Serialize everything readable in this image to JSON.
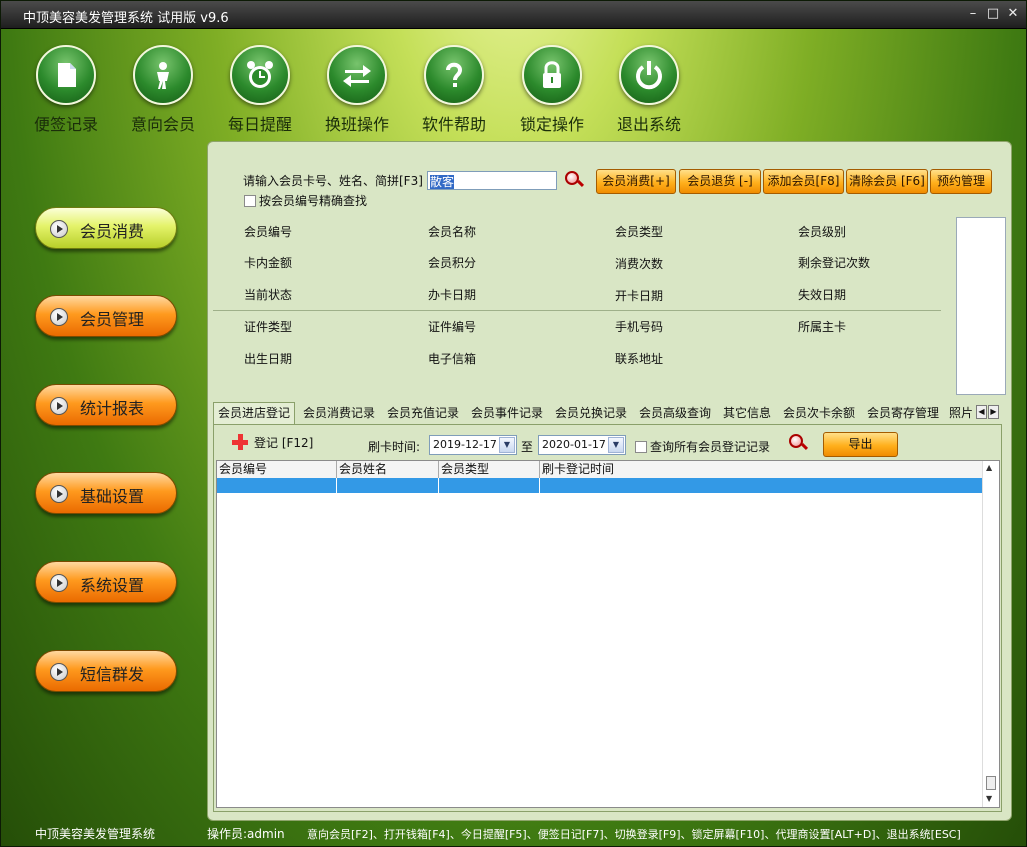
{
  "window": {
    "title": "中顶美容美发管理系统 试用版 v9.6",
    "controls": {
      "minimize": "–",
      "maximize": "□",
      "close": "✕"
    }
  },
  "toolbar": [
    {
      "label": "便签记录",
      "icon": "note-icon"
    },
    {
      "label": "意向会员",
      "icon": "person-icon"
    },
    {
      "label": "每日提醒",
      "icon": "alarm-clock-icon"
    },
    {
      "label": "换班操作",
      "icon": "swap-arrows-icon"
    },
    {
      "label": "软件帮助",
      "icon": "question-icon"
    },
    {
      "label": "锁定操作",
      "icon": "lock-icon"
    },
    {
      "label": "退出系统",
      "icon": "power-icon"
    }
  ],
  "sidebar": [
    {
      "label": "会员消费",
      "active": true
    },
    {
      "label": "会员管理",
      "active": false
    },
    {
      "label": "统计报表",
      "active": false
    },
    {
      "label": "基础设置",
      "active": false
    },
    {
      "label": "系统设置",
      "active": false
    },
    {
      "label": "短信群发",
      "active": false
    }
  ],
  "search": {
    "label": "请输入会员卡号、姓名、简拼[F3]",
    "value": "散客",
    "exact_label": "按会员编号精确查找",
    "exact_checked": false
  },
  "actions": [
    "会员消费[+]",
    "会员退货 [-]",
    "添加会员[F8]",
    "清除会员 [F6]",
    "预约管理"
  ],
  "info_fields": [
    [
      "会员编号",
      "会员名称",
      "会员类型",
      "会员级别"
    ],
    [
      "卡内金额",
      "会员积分",
      "消费次数",
      "剩余登记次数"
    ],
    [
      "当前状态",
      "办卡日期",
      "开卡日期",
      "失效日期"
    ],
    [
      "证件类型",
      "证件编号",
      "手机号码",
      "所属主卡"
    ],
    [
      "出生日期",
      "电子信箱",
      "联系地址"
    ]
  ],
  "tabs": [
    "会员进店登记",
    "会员消费记录",
    "会员充值记录",
    "会员事件记录",
    "会员兑换记录",
    "会员高级查询",
    "其它信息",
    "会员次卡余额",
    "会员寄存管理",
    "照片"
  ],
  "checkin": {
    "register_label": "登记 [F12]",
    "time_label": "刷卡时间:",
    "date_from": "2019-12-17",
    "to_label": "至",
    "date_to": "2020-01-17",
    "query_all_label": "查询所有会员登记记录",
    "query_all_checked": false,
    "export_label": "导出"
  },
  "grid": {
    "columns": [
      "会员编号",
      "会员姓名",
      "会员类型",
      "刷卡登记时间"
    ],
    "rows": [
      [
        "",
        "",
        "",
        ""
      ]
    ]
  },
  "status": {
    "app_name": "中顶美容美发管理系统",
    "operator": "操作员:admin",
    "shortcuts": "意向会员[F2]、打开钱箱[F4]、今日提醒[F5]、便签日记[F7]、切换登录[F9]、锁定屏幕[F10]、代理商设置[ALT+D]、退出系统[ESC]"
  }
}
